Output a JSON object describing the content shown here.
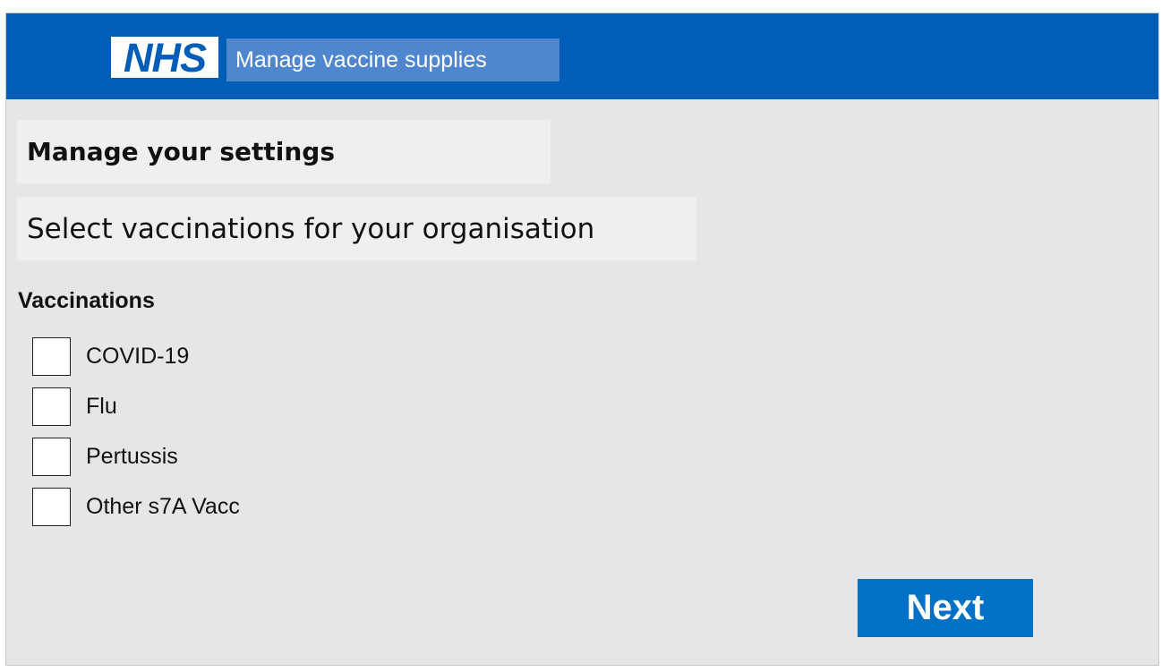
{
  "header": {
    "logo_text": "NHS",
    "service_name": "Manage vaccine supplies"
  },
  "page": {
    "title": "Manage your settings",
    "subtitle": "Select vaccinations for your organisation"
  },
  "form": {
    "legend": "Vaccinations",
    "options": [
      {
        "label": "COVID-19",
        "checked": false
      },
      {
        "label": "Flu",
        "checked": false
      },
      {
        "label": "Pertussis",
        "checked": false
      },
      {
        "label": "Other s7A Vacc",
        "checked": false
      }
    ],
    "next_label": "Next"
  },
  "colors": {
    "nhs_blue": "#005eb8",
    "service_name_bg": "#4f86cd",
    "button_bg": "#0071c5",
    "page_bg": "#e6e6e6"
  }
}
